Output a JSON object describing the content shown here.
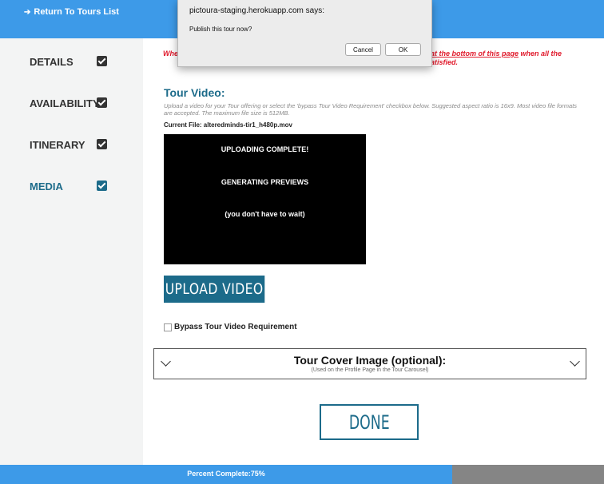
{
  "header": {
    "back_link": "Return To Tours List",
    "back_icon": "arrow-left-icon",
    "background_color": "#3d9ae8"
  },
  "sidebar": {
    "items": [
      {
        "label": "DETAILS",
        "checked": true
      },
      {
        "label": "AVAILABILITY",
        "checked": true
      },
      {
        "label": "ITINERARY",
        "checked": true
      },
      {
        "label": "MEDIA",
        "checked": true,
        "active": true
      }
    ],
    "active_color": "#1c6b8a"
  },
  "warning": {
    "left_fragment": "Whe",
    "link_text": "at the bottom of this page",
    "right_fragment": " when all the",
    "second_line": "atisfied.",
    "color": "#e0192b"
  },
  "video_section": {
    "title": "Tour Video:",
    "help": "Upload a video for your Tour offering or select the 'bypass Tour Video Requirement' checkbox below. Suggested aspect ratio is 16x9. Most video file formats are accepted. The maximum file size is 512MB.",
    "current_file": "Current File: alteredminds-tir1_h480p.mov",
    "status_lines": [
      "UPLOADING COMPLETE!",
      "GENERATING PREVIEWS",
      "(you don't have to wait)"
    ],
    "upload_button": "UPLOAD VIDEO",
    "bypass_label": "Bypass Tour Video Requirement",
    "bypass_checked": false
  },
  "cover_image": {
    "title": "Tour Cover Image (optional):",
    "subtitle": "(Used on the Profile Page in the Tour Carousel)",
    "expanded": false
  },
  "done_button": "DONE",
  "progress": {
    "label": "Percent Complete:75%",
    "percent": 75
  },
  "dialog": {
    "title": "pictoura-staging.herokuapp.com says:",
    "message": "Publish this tour now?",
    "cancel": "Cancel",
    "ok": "OK"
  }
}
